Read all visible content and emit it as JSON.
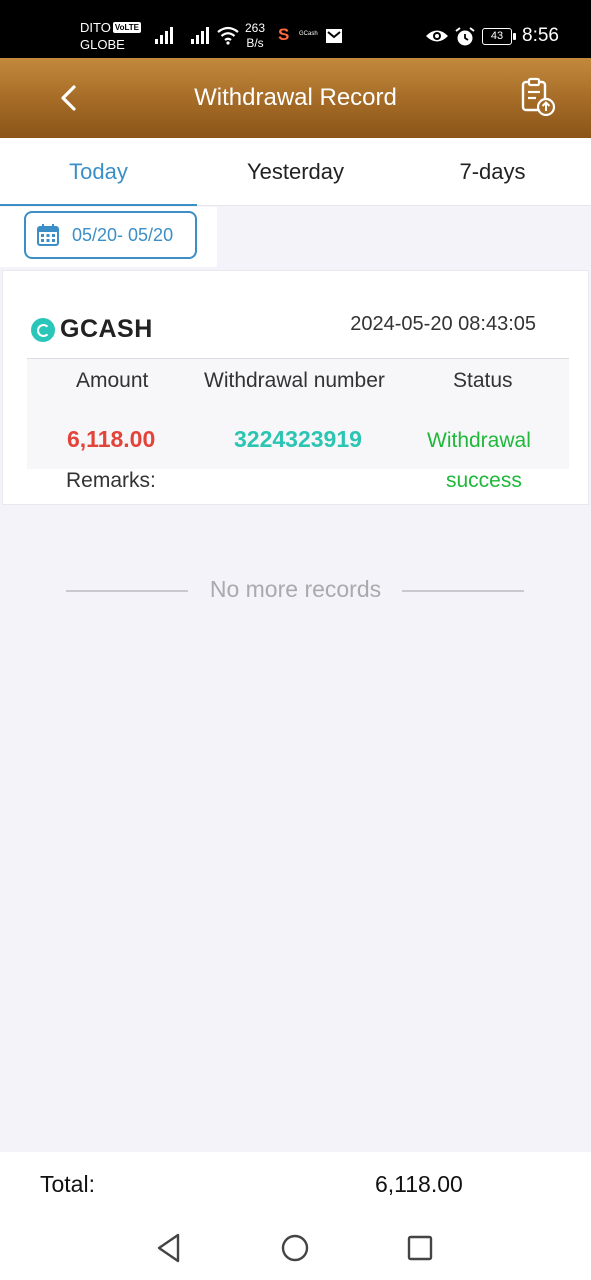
{
  "status_bar": {
    "carrier_top": "DITO",
    "volte": "VoLTE",
    "carrier_bottom": "GLOBE",
    "speed_value": "263",
    "speed_unit": "B/s",
    "app_letter": "S",
    "gcash_mini": "GCash",
    "battery": "43",
    "time": "8:56"
  },
  "header": {
    "title": "Withdrawal Record",
    "back_icon": "chevron-left-icon",
    "record_icon": "clipboard-upload-icon"
  },
  "tabs": [
    {
      "label": "Today",
      "active": true
    },
    {
      "label": "Yesterday",
      "active": false
    },
    {
      "label": "7-days",
      "active": false
    }
  ],
  "date_range": {
    "label": "05/20- 05/20",
    "icon": "calendar-icon"
  },
  "record": {
    "method": "GCASH",
    "datetime": "2024-05-20 08:43:05",
    "headers": {
      "amount": "Amount",
      "number": "Withdrawal number",
      "status": "Status"
    },
    "amount": "6,118.00",
    "number": "3224323919",
    "status_line1": "Withdrawal",
    "status_line2": "success",
    "remarks_label": "Remarks:"
  },
  "no_more": "No more records",
  "footer": {
    "total_label": "Total:",
    "total_value": "6,118.00"
  },
  "colors": {
    "accent": "#3c8fc6",
    "header_gold": "#a46a26",
    "amount_red": "#e2443a",
    "number_teal": "#2cc4b2",
    "status_green": "#1fb83a"
  }
}
